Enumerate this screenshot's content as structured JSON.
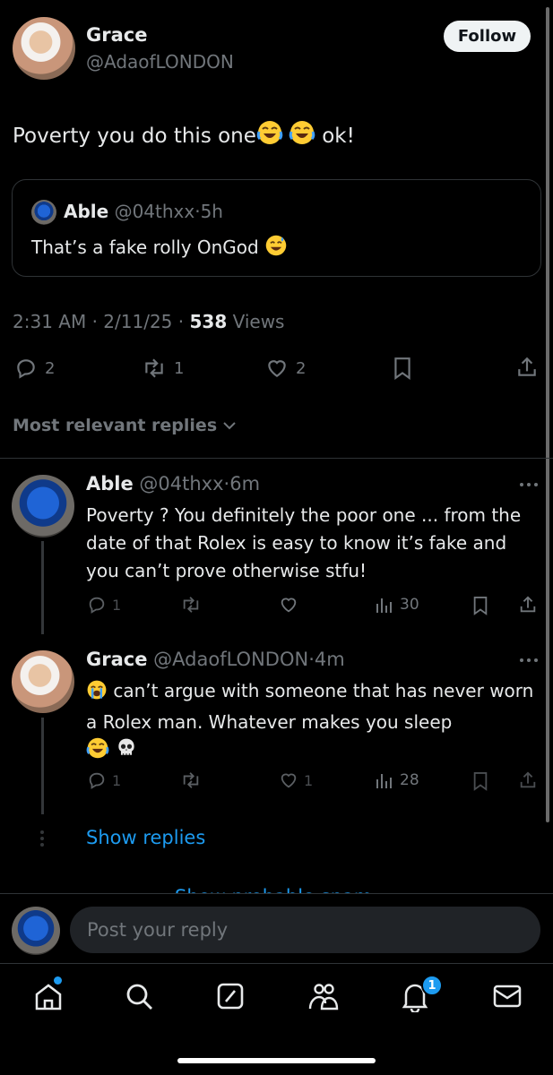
{
  "post": {
    "author_name": "Grace",
    "author_handle": "@AdaofLONDON",
    "follow_label": "Follow",
    "text": "Poverty you do this one",
    "text_suffix": " ok!",
    "quote": {
      "author_name": "Able",
      "author_handle": "@04thxx",
      "dot": "·",
      "time": "5h",
      "text": "That’s a fake rolly OnGod "
    },
    "time": "2:31 AM",
    "dot1": "·",
    "date": "2/11/25",
    "dot2": "·",
    "views_count": "538",
    "views_label": "Views",
    "replies": "2",
    "reposts": "1",
    "likes": "2"
  },
  "sort_label": "Most relevant replies",
  "replies": [
    {
      "author_name": "Able",
      "author_handle": "@04thxx",
      "dot": "·",
      "time": "6m",
      "text": "Poverty ? You definitely the poor one ... from the date of that Rolex is easy to know it’s fake and you can’t prove otherwise stfu!",
      "replies": "1",
      "likes": "",
      "views": "30"
    },
    {
      "author_name": "Grace",
      "author_handle": "@AdaofLONDON",
      "dot": "·",
      "time": "4m",
      "text": "can’t argue with someone that has never worn a Rolex man. Whatever makes you sleep",
      "replies": "1",
      "likes": "1",
      "views": "28"
    }
  ],
  "show_replies_label": "Show replies",
  "show_more_label": "Show probable spam",
  "composer": {
    "placeholder": "Post your reply"
  },
  "nav": {
    "notifications_badge": "1"
  },
  "colors": {
    "accent": "#1d9bf0",
    "muted": "#71767b",
    "text": "#e7e9ea",
    "border": "#2f3336"
  }
}
